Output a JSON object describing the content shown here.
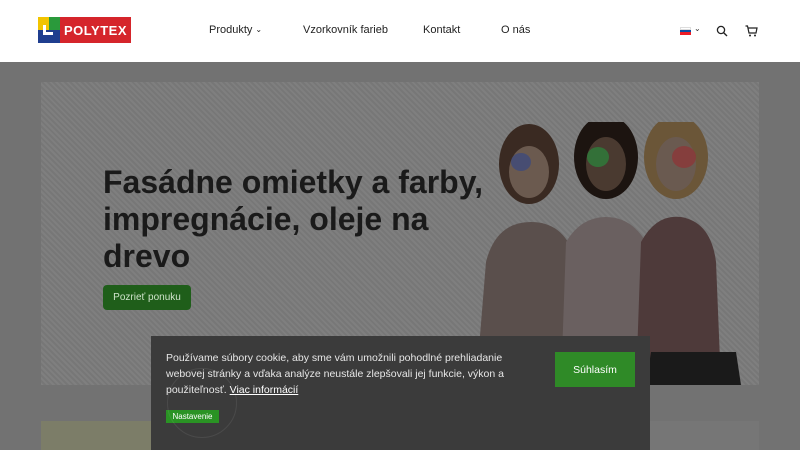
{
  "brand": {
    "logo_text": "POLYTEX"
  },
  "nav": {
    "items": [
      {
        "label": "Produkty",
        "has_dropdown": true
      },
      {
        "label": "Vzorkovník farieb"
      },
      {
        "label": "Kontakt"
      },
      {
        "label": "O nás"
      }
    ]
  },
  "header_icons": {
    "language": "slovak-flag-icon",
    "search": "search-icon",
    "cart": "cart-icon"
  },
  "hero": {
    "title": "Fasádne omietky a farby, impregnácie, oleje na drevo",
    "button_label": "Pozrieť ponuku"
  },
  "cookie": {
    "text": "Používame súbory cookie, aby sme vám umožnili pohodlné prehliadanie webovej stránky a vďaka analýze neustále zlepšovali jej funkcie, výkon a použiteľnosť.",
    "link_label": "Viac informácií",
    "settings_label": "Nastavenie",
    "accept_label": "Súhlasím"
  },
  "colors": {
    "accent_green": "#2f8a27",
    "logo_red": "#d5252b",
    "overlay_gray": "#727272"
  }
}
